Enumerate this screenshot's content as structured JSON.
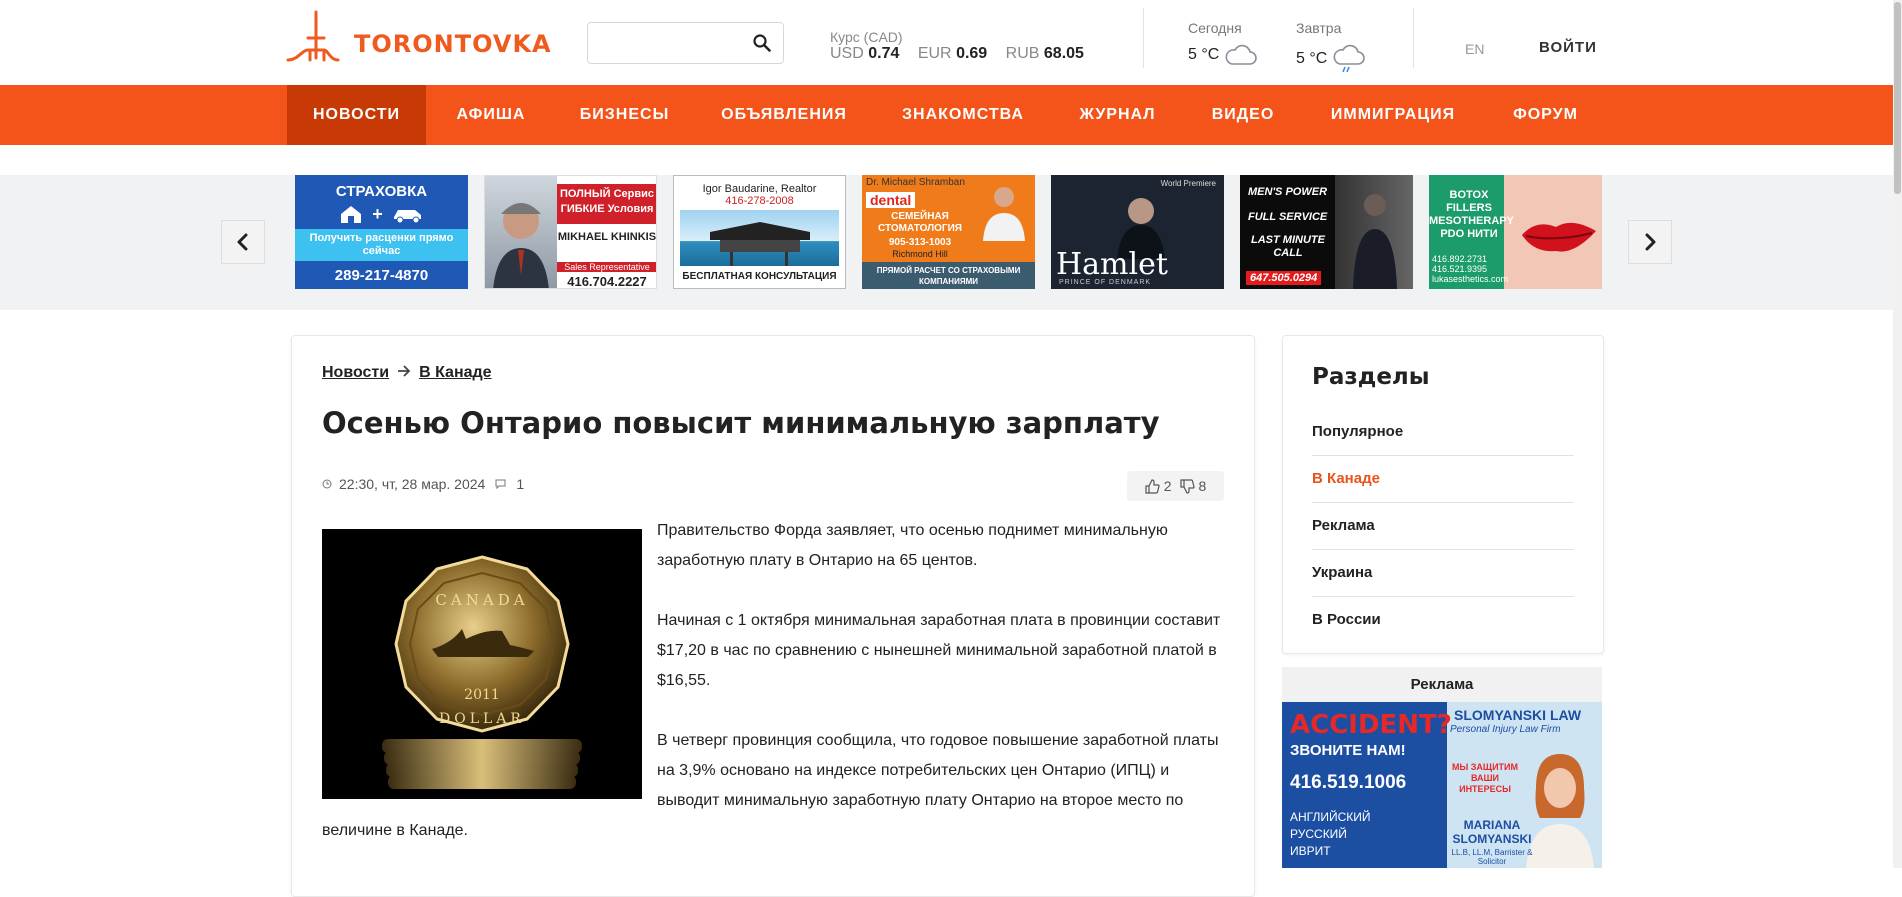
{
  "header": {
    "logo_text": "TORONTOVKA",
    "search": {
      "placeholder": "",
      "value": ""
    },
    "rates": {
      "label": "Курс (CAD)",
      "items": [
        {
          "currency": "USD",
          "value": "0.74"
        },
        {
          "currency": "EUR",
          "value": "0.69"
        },
        {
          "currency": "RUB",
          "value": "68.05"
        }
      ]
    },
    "weather": [
      {
        "label": "Сегодня",
        "temp": "5 °C",
        "icon": "cloud-icon"
      },
      {
        "label": "Завтра",
        "temp": "5 °C",
        "icon": "rain-cloud-icon"
      }
    ],
    "lang": "EN",
    "login": "ВОЙТИ"
  },
  "nav": {
    "items": [
      {
        "label": "НОВОСТИ",
        "active": true
      },
      {
        "label": "АФИША"
      },
      {
        "label": "БИЗНЕСЫ"
      },
      {
        "label": "ОБЪЯВЛЕНИЯ"
      },
      {
        "label": "ЗНАКОМСТВА"
      },
      {
        "label": "ЖУРНАЛ"
      },
      {
        "label": "ВИДЕО"
      },
      {
        "label": "ИММИГРАЦИЯ"
      },
      {
        "label": "ФОРУМ"
      }
    ]
  },
  "banners": [
    {
      "line1": "СТРАХОВКА",
      "line2": "Получить расценки прямо сейчас",
      "line3": "289-217-4870"
    },
    {
      "line1": "ПОЛНЫЙ Сервис",
      "line2": "ГИБКИЕ Условия",
      "line3": "MIKHAEL KHINKIS",
      "line4": "Sales Representative",
      "line5": "416.704.2227"
    },
    {
      "line1": "Igor Baudarine, Realtor",
      "line2": "416-278-2008",
      "line3": "БЕСПЛАТНАЯ КОНСУЛЬТАЦИЯ"
    },
    {
      "line1": "Dr. Michael Shramban",
      "line2": "dental",
      "line3": "СЕМЕЙНАЯ СТОМАТОЛОГИЯ",
      "line4": "905-313-1003",
      "line5": "Richmond Hill",
      "line6": "ПРЯМОЙ РАСЧЕТ СО СТРАХОВЫМИ КОМПАНИЯМИ"
    },
    {
      "line1": "World Premiere",
      "line2": "Hamlet",
      "line3": "PRINCE OF DENMARK"
    },
    {
      "line1": "MEN'S POWER",
      "line2": "FULL SERVICE",
      "line3": "LAST MINUTE CALL",
      "line4": "647.505.0294"
    },
    {
      "line1": "BOTOX",
      "line2": "FILLERS",
      "line3": "MESOTHERAPY",
      "line4": "PDO НИТИ",
      "line5": "416.892.2731",
      "line6": "416.521.9395",
      "line7": "lukasesthetics.com"
    }
  ],
  "article": {
    "breadcrumbs": [
      "Новости",
      "В Канаде"
    ],
    "title": "Осенью Онтарио повысит минимальную зарплату",
    "datetime": "22:30, чт, 28 мар. 2024",
    "comments": "1",
    "likes": "2",
    "dislikes": "8",
    "image_text": {
      "top": "CANADA",
      "year": "2011",
      "bottom": "DOLLAR"
    },
    "paragraphs": [
      "Правительство Форда заявляет, что осенью поднимет минимальную заработную плату в Онтарио на 65 центов.",
      "Начиная с 1 октября минимальная заработная плата в провинции составит $17,20 в час по сравнению с нынешней минимальной заработной платой в $16,55.",
      "В четверг провинция сообщила, что годовое повышение заработной платы на 3,9% основано на индексе потребительских цен Онтарио (ИПЦ) и выводит минимальную заработную плату Онтарио на второе место по величине в Канаде."
    ]
  },
  "sidebar": {
    "title": "Разделы",
    "items": [
      {
        "label": "Популярное"
      },
      {
        "label": "В Канаде",
        "active": true
      },
      {
        "label": "Реклама"
      },
      {
        "label": "Украина"
      },
      {
        "label": "В России"
      }
    ]
  },
  "side_ad": {
    "label": "Реклама",
    "headline": "ACCIDENT?",
    "sub": "ЗВОНИТЕ НАМ!",
    "phone": "416.519.1006",
    "langs": [
      "АНГЛИЙСКИЙ",
      "РУССКИЙ",
      "ИВРИТ"
    ],
    "firm": "SLOMYANSKI LAW",
    "firm_sub": "Personal Injury Law Firm",
    "slogan": "МЫ ЗАЩИТИМ ВАШИ ИНТЕРЕСЫ",
    "name": "MARIANA SLOMYANSKI",
    "credentials": "LL.B, LL.M, Barrister & Solicitor"
  }
}
